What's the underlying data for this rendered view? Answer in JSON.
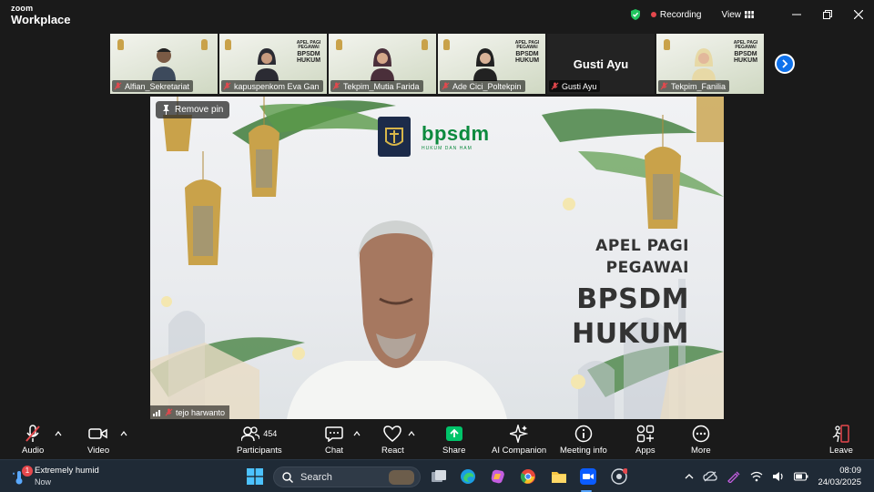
{
  "app": {
    "brand_top": "zoom",
    "brand_bottom": "Workplace"
  },
  "header": {
    "recording_label": "Recording",
    "view_label": "View"
  },
  "gallery": [
    {
      "name": "Alfian_Sekretariat",
      "muted": true,
      "has_video": true
    },
    {
      "name": "kapuspenkom Eva Gan",
      "muted": true,
      "has_video": true
    },
    {
      "name": "Tekpim_Mutia Farida",
      "muted": true,
      "has_video": true
    },
    {
      "name": "Ade Cici_Poltekpin",
      "muted": true,
      "has_video": true
    },
    {
      "name": "Gusti Ayu",
      "muted": true,
      "has_video": false,
      "display_name": "Gusti Ayu"
    },
    {
      "name": "Tekpim_Fanilia",
      "muted": true,
      "has_video": true
    }
  ],
  "tile_backdrop": {
    "line1": "APEL PAGI",
    "line2": "PEGAWAI",
    "line3": "BPSDM",
    "line4": "HUKUM",
    "logo": "bpsdm"
  },
  "main_video": {
    "pin_label": "Remove pin",
    "speaker_name": "tejo harwanto",
    "brand_text": "bpsdm",
    "brand_sub": "HUKUM DAN HAM",
    "banner": [
      "APEL PAGI",
      "PEGAWAI",
      "BPSDM",
      "HUKUM"
    ]
  },
  "toolbar": {
    "audio": "Audio",
    "video": "Video",
    "participants": "Participants",
    "participant_count": "454",
    "chat": "Chat",
    "react": "React",
    "share": "Share",
    "ai_companion": "AI Companion",
    "meeting_info": "Meeting info",
    "apps": "Apps",
    "more": "More",
    "leave": "Leave"
  },
  "taskbar": {
    "weather_title": "Extremely humid",
    "weather_sub": "Now",
    "weather_badge": "1",
    "search_label": "Search",
    "time": "08:09",
    "date": "24/03/2025"
  },
  "colors": {
    "accent": "#0e71eb",
    "share_green": "#00c46a",
    "recording_red": "#e5484d",
    "leave_red": "#e5484d"
  }
}
